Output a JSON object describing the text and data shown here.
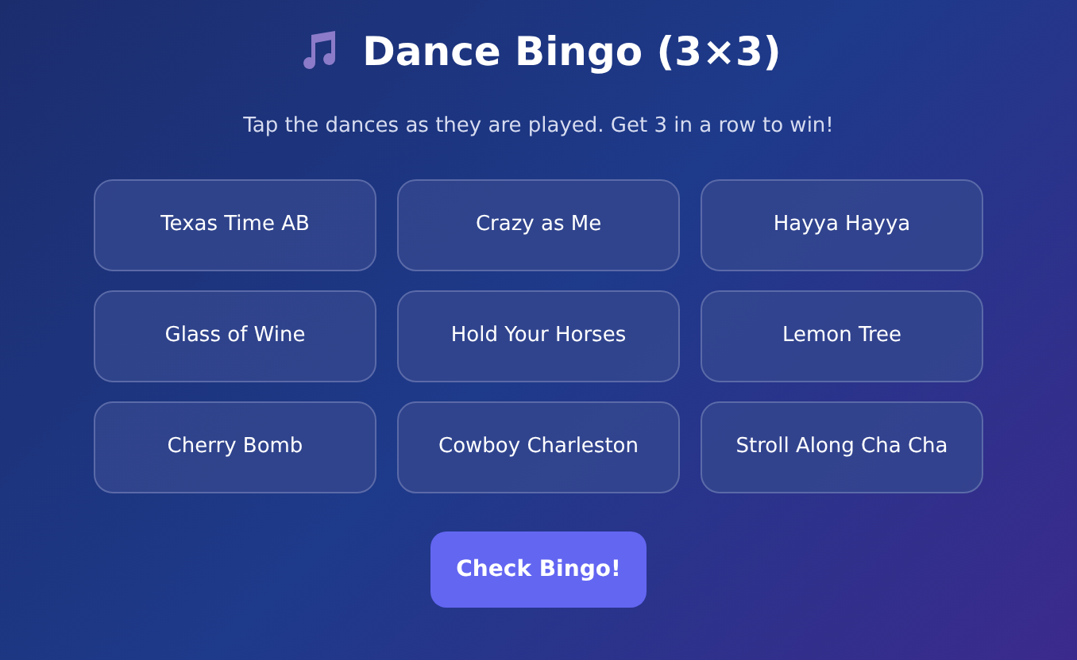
{
  "title": "Dance Bingo (3×3)",
  "subtitle": "Tap the dances as they are played. Get 3 in a row to win!",
  "cells": [
    {
      "label": "Texas Time AB",
      "selected": false
    },
    {
      "label": "Crazy as Me",
      "selected": false
    },
    {
      "label": "Hayya Hayya",
      "selected": false
    },
    {
      "label": "Glass of Wine",
      "selected": false
    },
    {
      "label": "Hold Your Horses",
      "selected": false
    },
    {
      "label": "Lemon Tree",
      "selected": false
    },
    {
      "label": "Cherry Bomb",
      "selected": false
    },
    {
      "label": "Cowboy Charleston",
      "selected": false
    },
    {
      "label": "Stroll Along Cha Cha",
      "selected": false
    }
  ],
  "button": "Check Bingo!"
}
